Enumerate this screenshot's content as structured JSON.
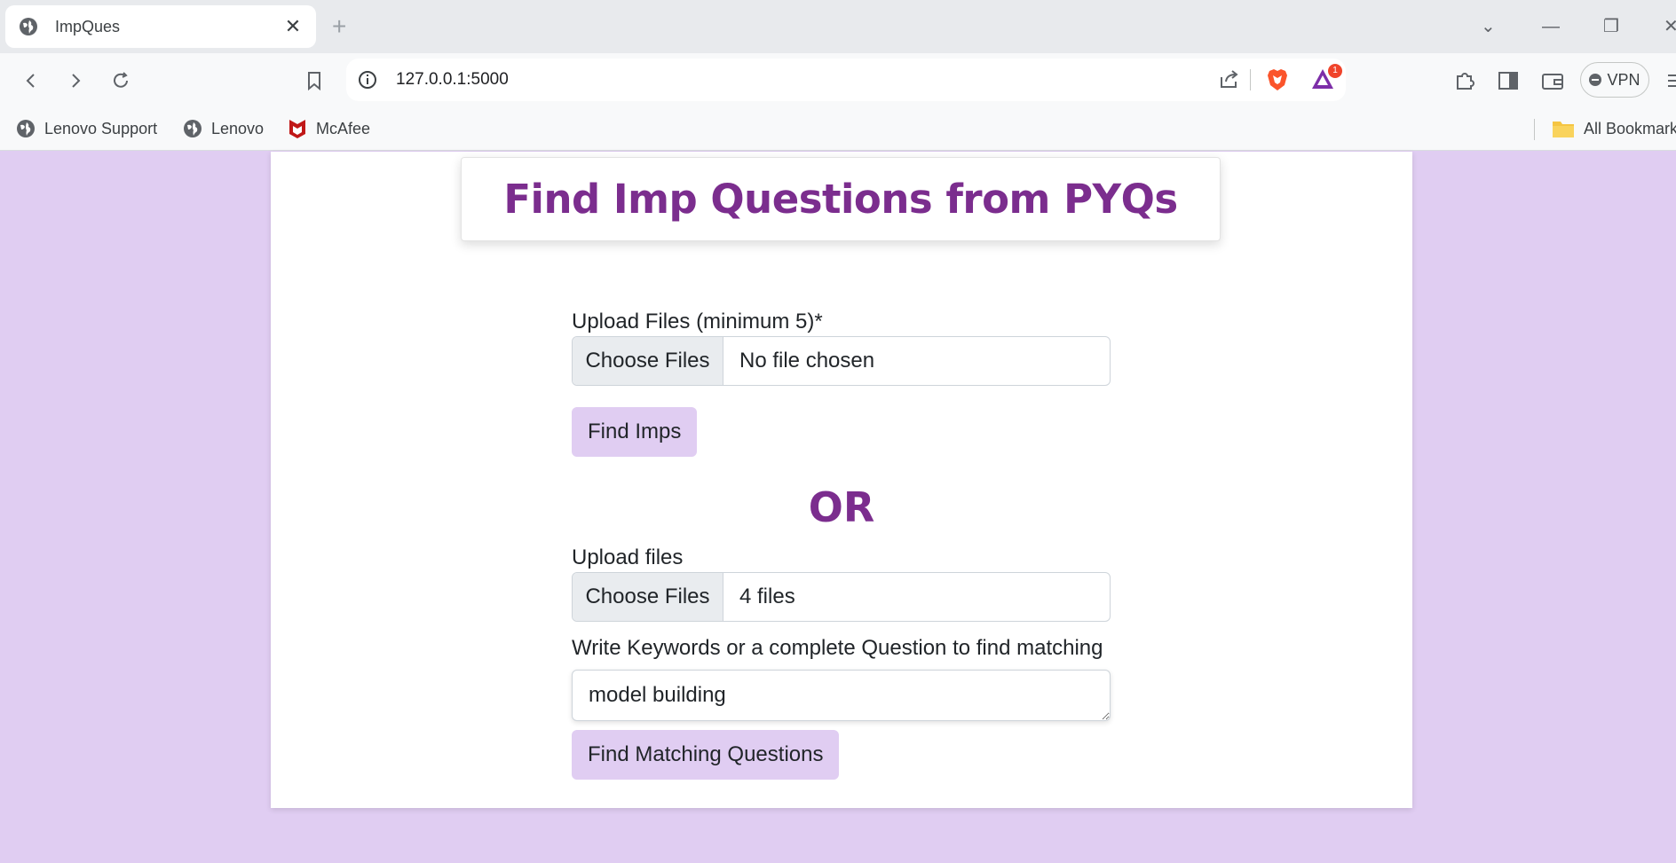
{
  "browser": {
    "tab_title": "ImpQues",
    "url": "127.0.0.1:5000",
    "rewards_badge": "1",
    "vpn_label": "VPN",
    "bookmarks": [
      {
        "label": "Lenovo Support",
        "icon": "globe-icon"
      },
      {
        "label": "Lenovo",
        "icon": "globe-icon"
      },
      {
        "label": "McAfee",
        "icon": "mcafee-icon"
      }
    ],
    "all_bookmarks_label": "All Bookmarks"
  },
  "page": {
    "heading": "Find Imp Questions from PYQs",
    "section1": {
      "upload_label": "Upload Files (minimum 5)*",
      "choose_label": "Choose Files",
      "file_status": "No file chosen",
      "submit_label": "Find Imps"
    },
    "or_label": "OR",
    "section2": {
      "upload_label": "Upload files",
      "choose_label": "Choose Files",
      "file_status": "4 files",
      "keywords_label": "Write Keywords or a complete Question to find matching",
      "keywords_value": "model building",
      "submit_label": "Find Matching Questions"
    }
  },
  "colors": {
    "background": "#e0cdf2",
    "heading": "#7b2d8e",
    "button": "#e0cdf2"
  }
}
